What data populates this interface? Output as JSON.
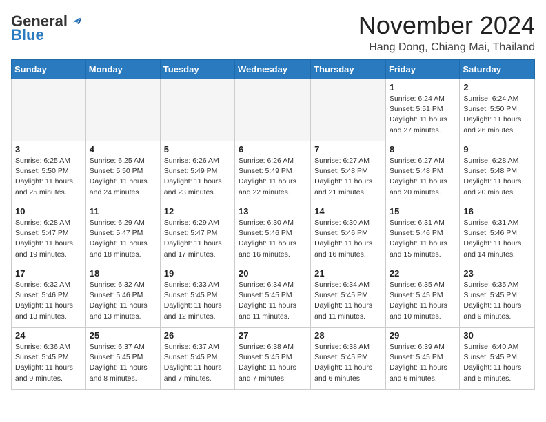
{
  "header": {
    "logo_general": "General",
    "logo_blue": "Blue",
    "month_title": "November 2024",
    "location": "Hang Dong, Chiang Mai, Thailand"
  },
  "calendar": {
    "days_of_week": [
      "Sunday",
      "Monday",
      "Tuesday",
      "Wednesday",
      "Thursday",
      "Friday",
      "Saturday"
    ],
    "weeks": [
      [
        {
          "day": "",
          "info": ""
        },
        {
          "day": "",
          "info": ""
        },
        {
          "day": "",
          "info": ""
        },
        {
          "day": "",
          "info": ""
        },
        {
          "day": "",
          "info": ""
        },
        {
          "day": "1",
          "info": "Sunrise: 6:24 AM\nSunset: 5:51 PM\nDaylight: 11 hours and 27 minutes."
        },
        {
          "day": "2",
          "info": "Sunrise: 6:24 AM\nSunset: 5:50 PM\nDaylight: 11 hours and 26 minutes."
        }
      ],
      [
        {
          "day": "3",
          "info": "Sunrise: 6:25 AM\nSunset: 5:50 PM\nDaylight: 11 hours and 25 minutes."
        },
        {
          "day": "4",
          "info": "Sunrise: 6:25 AM\nSunset: 5:50 PM\nDaylight: 11 hours and 24 minutes."
        },
        {
          "day": "5",
          "info": "Sunrise: 6:26 AM\nSunset: 5:49 PM\nDaylight: 11 hours and 23 minutes."
        },
        {
          "day": "6",
          "info": "Sunrise: 6:26 AM\nSunset: 5:49 PM\nDaylight: 11 hours and 22 minutes."
        },
        {
          "day": "7",
          "info": "Sunrise: 6:27 AM\nSunset: 5:48 PM\nDaylight: 11 hours and 21 minutes."
        },
        {
          "day": "8",
          "info": "Sunrise: 6:27 AM\nSunset: 5:48 PM\nDaylight: 11 hours and 20 minutes."
        },
        {
          "day": "9",
          "info": "Sunrise: 6:28 AM\nSunset: 5:48 PM\nDaylight: 11 hours and 20 minutes."
        }
      ],
      [
        {
          "day": "10",
          "info": "Sunrise: 6:28 AM\nSunset: 5:47 PM\nDaylight: 11 hours and 19 minutes."
        },
        {
          "day": "11",
          "info": "Sunrise: 6:29 AM\nSunset: 5:47 PM\nDaylight: 11 hours and 18 minutes."
        },
        {
          "day": "12",
          "info": "Sunrise: 6:29 AM\nSunset: 5:47 PM\nDaylight: 11 hours and 17 minutes."
        },
        {
          "day": "13",
          "info": "Sunrise: 6:30 AM\nSunset: 5:46 PM\nDaylight: 11 hours and 16 minutes."
        },
        {
          "day": "14",
          "info": "Sunrise: 6:30 AM\nSunset: 5:46 PM\nDaylight: 11 hours and 16 minutes."
        },
        {
          "day": "15",
          "info": "Sunrise: 6:31 AM\nSunset: 5:46 PM\nDaylight: 11 hours and 15 minutes."
        },
        {
          "day": "16",
          "info": "Sunrise: 6:31 AM\nSunset: 5:46 PM\nDaylight: 11 hours and 14 minutes."
        }
      ],
      [
        {
          "day": "17",
          "info": "Sunrise: 6:32 AM\nSunset: 5:46 PM\nDaylight: 11 hours and 13 minutes."
        },
        {
          "day": "18",
          "info": "Sunrise: 6:32 AM\nSunset: 5:46 PM\nDaylight: 11 hours and 13 minutes."
        },
        {
          "day": "19",
          "info": "Sunrise: 6:33 AM\nSunset: 5:45 PM\nDaylight: 11 hours and 12 minutes."
        },
        {
          "day": "20",
          "info": "Sunrise: 6:34 AM\nSunset: 5:45 PM\nDaylight: 11 hours and 11 minutes."
        },
        {
          "day": "21",
          "info": "Sunrise: 6:34 AM\nSunset: 5:45 PM\nDaylight: 11 hours and 11 minutes."
        },
        {
          "day": "22",
          "info": "Sunrise: 6:35 AM\nSunset: 5:45 PM\nDaylight: 11 hours and 10 minutes."
        },
        {
          "day": "23",
          "info": "Sunrise: 6:35 AM\nSunset: 5:45 PM\nDaylight: 11 hours and 9 minutes."
        }
      ],
      [
        {
          "day": "24",
          "info": "Sunrise: 6:36 AM\nSunset: 5:45 PM\nDaylight: 11 hours and 9 minutes."
        },
        {
          "day": "25",
          "info": "Sunrise: 6:37 AM\nSunset: 5:45 PM\nDaylight: 11 hours and 8 minutes."
        },
        {
          "day": "26",
          "info": "Sunrise: 6:37 AM\nSunset: 5:45 PM\nDaylight: 11 hours and 7 minutes."
        },
        {
          "day": "27",
          "info": "Sunrise: 6:38 AM\nSunset: 5:45 PM\nDaylight: 11 hours and 7 minutes."
        },
        {
          "day": "28",
          "info": "Sunrise: 6:38 AM\nSunset: 5:45 PM\nDaylight: 11 hours and 6 minutes."
        },
        {
          "day": "29",
          "info": "Sunrise: 6:39 AM\nSunset: 5:45 PM\nDaylight: 11 hours and 6 minutes."
        },
        {
          "day": "30",
          "info": "Sunrise: 6:40 AM\nSunset: 5:45 PM\nDaylight: 11 hours and 5 minutes."
        }
      ]
    ]
  }
}
